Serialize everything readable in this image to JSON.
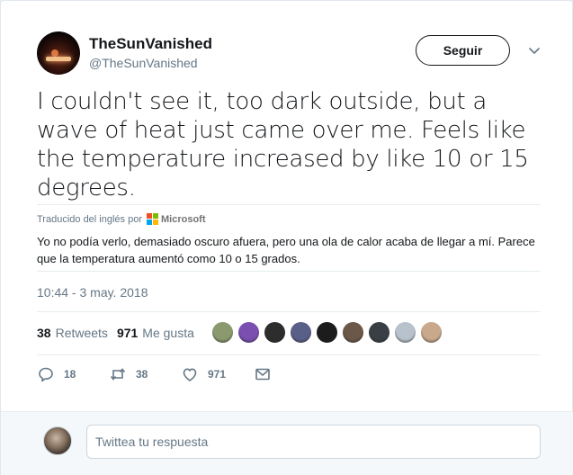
{
  "user": {
    "name": "TheSunVanished",
    "handle": "@TheSunVanished"
  },
  "follow_label": "Seguir",
  "tweet_text": "I couldn't see it, too dark outside, but a wave of heat just came over me. Feels like the temperature increased by like 10 or 15 degrees.",
  "translation": {
    "label": "Traducido del inglés por",
    "provider": "Microsoft",
    "text": "Yo no podía verlo, demasiado oscuro afuera, pero una ola de calor acaba de llegar a mí. Parece que la temperatura aumentó como 10 o 15 grados."
  },
  "timestamp": "10:44 - 3 may. 2018",
  "stats": {
    "retweets_count": "38",
    "retweets_label": "Retweets",
    "likes_count": "971",
    "likes_label": "Me gusta"
  },
  "likers": [
    "#8a9a6e",
    "#7b4fb0",
    "#2d2d2d",
    "#5a5f8a",
    "#1c1c1c",
    "#6b5848",
    "#3a3f45",
    "#b8c2cc",
    "#c9a88c"
  ],
  "actions": {
    "reply_count": "18",
    "retweet_count": "38",
    "like_count": "971"
  },
  "reply_placeholder": "Twittea tu respuesta",
  "icons": {
    "caret": "chevron-down-icon",
    "reply": "reply-icon",
    "retweet": "retweet-icon",
    "like": "heart-icon",
    "dm": "envelope-icon"
  },
  "colors": {
    "muted": "#657786",
    "text": "#14171a",
    "border": "#e6ecf0",
    "ms_red": "#f25022",
    "ms_green": "#7fba00",
    "ms_blue": "#00a4ef",
    "ms_yellow": "#ffb900"
  }
}
